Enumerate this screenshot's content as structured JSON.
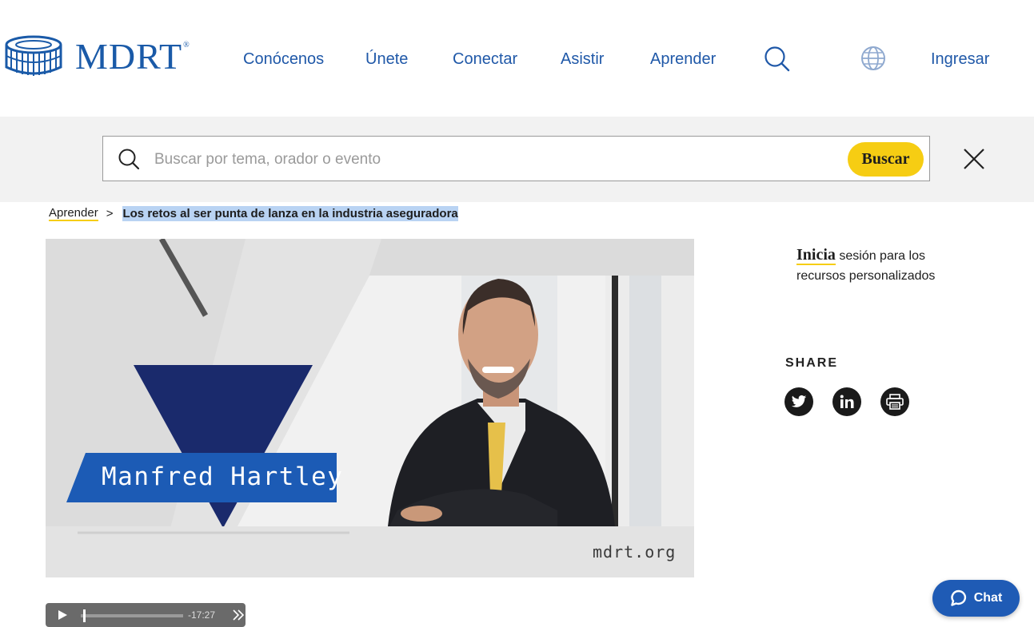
{
  "brand": {
    "name": "MDRT",
    "registered": "®",
    "color": "#1a5aa8"
  },
  "nav": {
    "items": [
      "Conócenos",
      "Únete",
      "Conectar",
      "Asistir",
      "Aprender"
    ],
    "search_icon": "search-icon",
    "language_icon": "globe-icon",
    "login": "Ingresar"
  },
  "search": {
    "placeholder": "Buscar por tema, orador o evento",
    "value": "",
    "button": "Buscar",
    "close_icon": "close-icon",
    "button_color": "#f6cd13"
  },
  "breadcrumb": {
    "parent": "Aprender",
    "separator": ">",
    "current": "Los retos al ser punta de lanza en la industria aseguradora"
  },
  "video": {
    "speaker_name": "Manfred Hartley",
    "watermark": "mdrt.org",
    "time_remaining": "-17:27",
    "progress": 0.02
  },
  "sidebar": {
    "login_link": "Inicia",
    "login_text": "sesión para los recursos personalizados",
    "share_label": "SHARE",
    "share_icons": [
      "twitter-icon",
      "linkedin-icon",
      "print-icon"
    ]
  },
  "chat": {
    "label": "Chat",
    "color": "#1f5bb5"
  }
}
